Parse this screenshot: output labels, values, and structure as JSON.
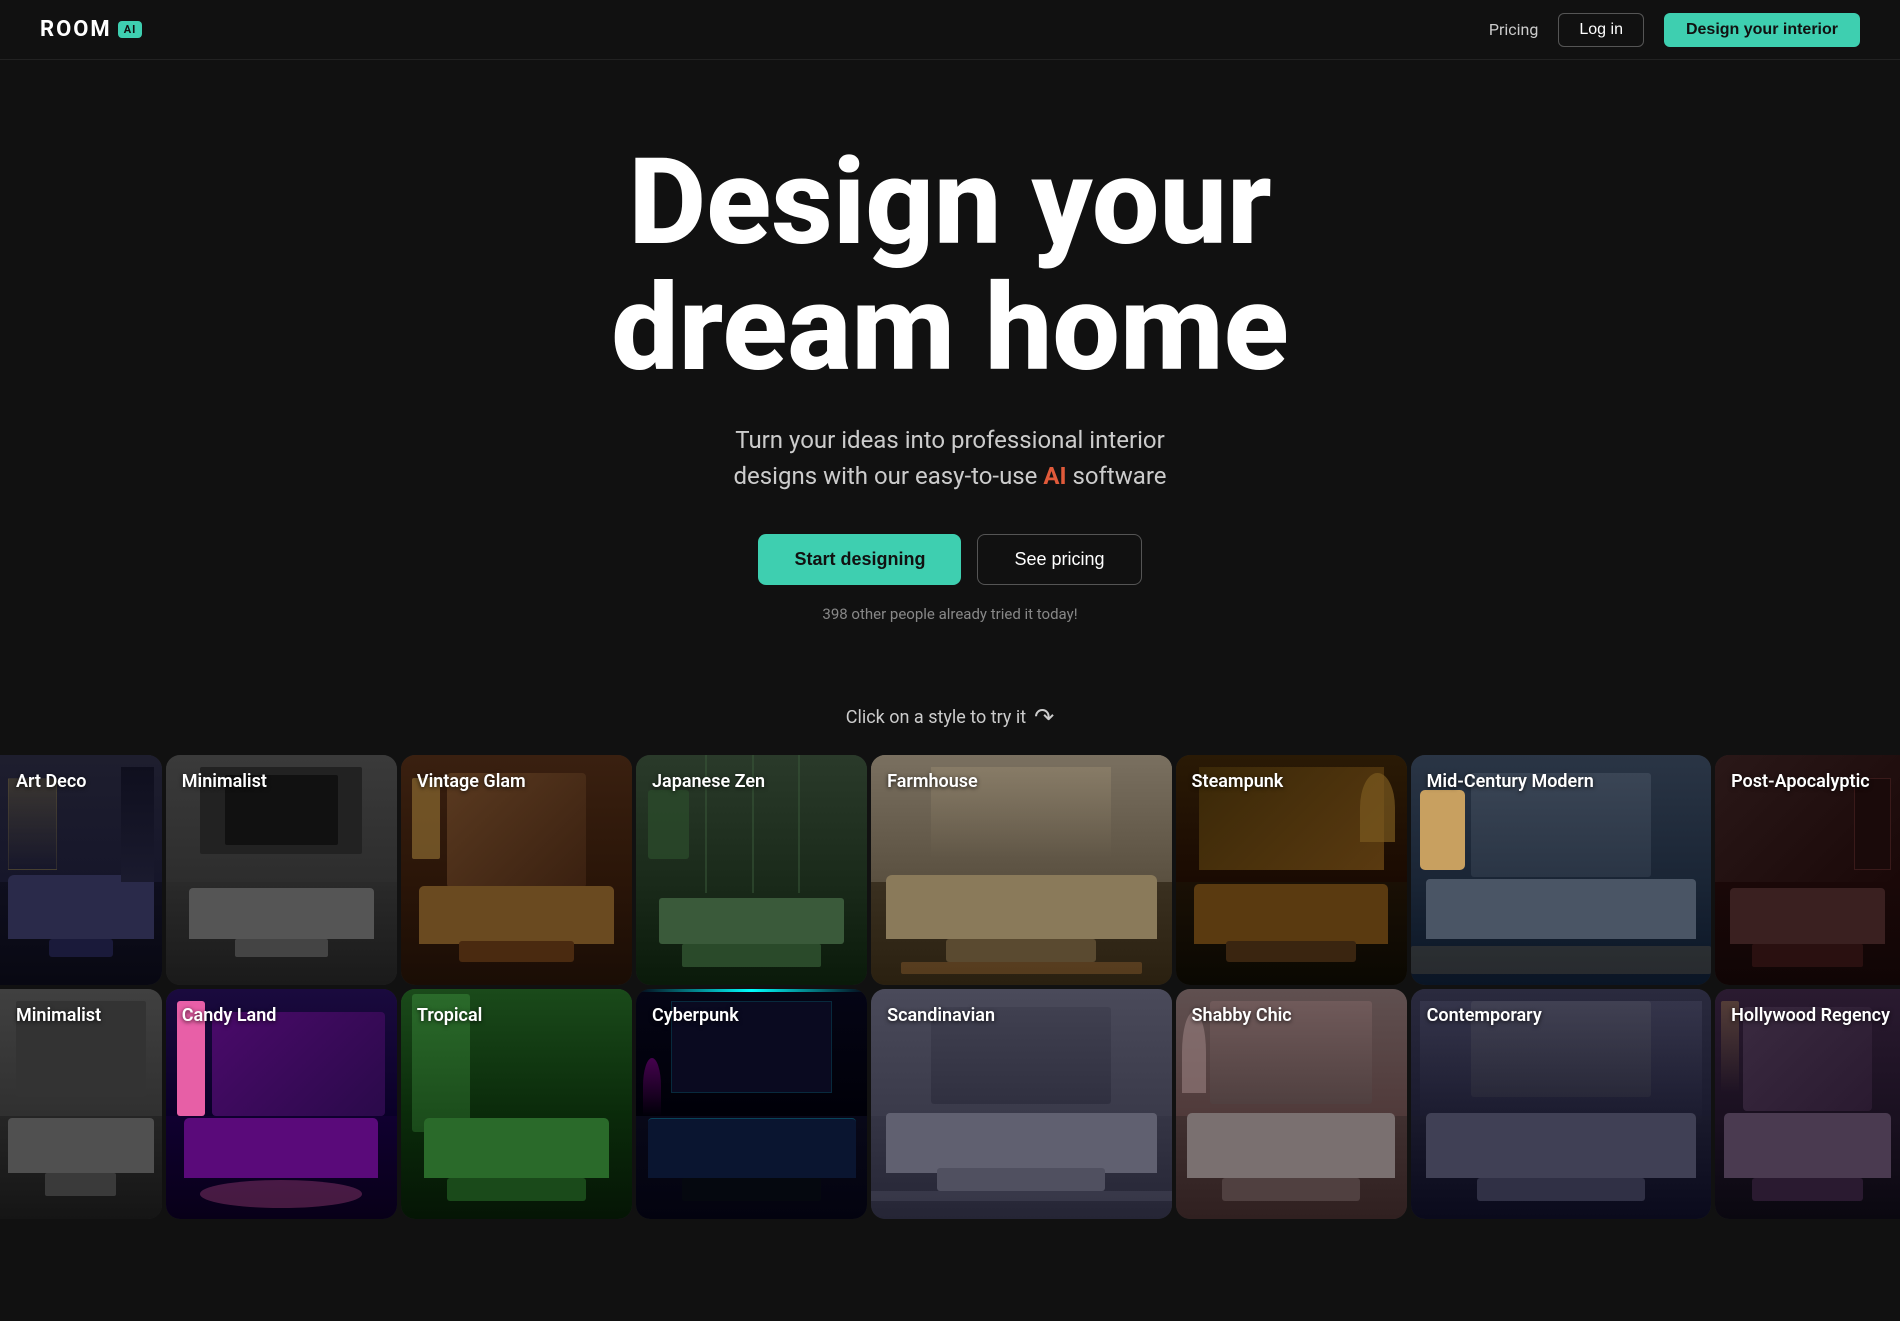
{
  "nav": {
    "logo_text": "ROOM",
    "logo_badge": "AI",
    "pricing_label": "Pricing",
    "login_label": "Log in",
    "cta_label": "Design your interior"
  },
  "hero": {
    "title_line1": "Design your",
    "title_line2": "dream home",
    "subtitle_part1": "Turn your ideas into professional interior",
    "subtitle_part2": "designs with our easy-to-use",
    "subtitle_ai": "AI",
    "subtitle_part3": "software",
    "btn_start": "Start designing",
    "btn_pricing": "See pricing",
    "social_proof": "398 other people already tried it today!"
  },
  "styles_section": {
    "hint_text": "Click on a style to try it",
    "row1": [
      {
        "id": "art-deco",
        "label": "Art Deco",
        "partial": "left"
      },
      {
        "id": "minimalist",
        "label": "Minimalist",
        "partial": ""
      },
      {
        "id": "vintage-glam",
        "label": "Vintage Glam",
        "partial": ""
      },
      {
        "id": "japanese-zen",
        "label": "Japanese Zen",
        "partial": ""
      },
      {
        "id": "farmhouse",
        "label": "Farmhouse",
        "partial": ""
      },
      {
        "id": "steampunk",
        "label": "Steampunk",
        "partial": ""
      },
      {
        "id": "mid-century-modern",
        "label": "Mid-Century Modern",
        "partial": ""
      },
      {
        "id": "post-apocalyptic",
        "label": "Post-Apocalyptic",
        "partial": "right"
      }
    ],
    "row2": [
      {
        "id": "minimalist2",
        "label": "Minimalist",
        "partial": "left"
      },
      {
        "id": "candy-land",
        "label": "Candy Land",
        "partial": ""
      },
      {
        "id": "tropical",
        "label": "Tropical",
        "partial": ""
      },
      {
        "id": "cyberpunk",
        "label": "Cyberpunk",
        "partial": ""
      },
      {
        "id": "scandinavian",
        "label": "Scandinavian",
        "partial": ""
      },
      {
        "id": "shabby-chic",
        "label": "Shabby Chic",
        "partial": ""
      },
      {
        "id": "contemporary",
        "label": "Contemporary",
        "partial": ""
      },
      {
        "id": "hollywood-regency",
        "label": "Hollywood Regency",
        "partial": "right"
      }
    ]
  },
  "colors": {
    "teal": "#3ecfb0",
    "orange": "#e05a3a",
    "dark_bg": "#111111",
    "border": "#333333"
  },
  "room_styles": {
    "art-deco": {
      "wall": "#1e1e2e",
      "floor": "#0f0f1e",
      "sofa": "#2a2a4a",
      "table": "#1a1a3a",
      "accent1": "#8a7a3a",
      "accent2": "#4a3a8a"
    },
    "minimalist": {
      "wall": "#3a3a3a",
      "floor": "#2a2a2a",
      "sofa": "#4a4a4a",
      "table": "#383838",
      "accent1": "#606060",
      "accent2": "#505050"
    },
    "vintage-glam": {
      "wall": "#3a2010",
      "floor": "#2a1508",
      "sofa": "#5a3a20",
      "table": "#4a2a15",
      "accent1": "#8a6a30",
      "accent2": "#6a4a20"
    },
    "japanese-zen": {
      "wall": "#2a3a2a",
      "floor": "#1a2a1a",
      "sofa": "#3a5a3a",
      "table": "#2a4a2a",
      "accent1": "#5a7a5a",
      "accent2": "#4a6a4a"
    },
    "farmhouse": {
      "wall": "#5a5040",
      "floor": "#3a3025",
      "sofa": "#7a6a4a",
      "table": "#5a4a30",
      "accent1": "#9a8a6a",
      "accent2": "#7a6a4a"
    },
    "steampunk": {
      "wall": "#3a2808",
      "floor": "#1a1208",
      "sofa": "#5a3a10",
      "table": "#3a2808",
      "accent1": "#7a5a20",
      "accent2": "#9a7a30"
    },
    "mid-century-modern": {
      "wall": "#2a3545",
      "floor": "#1a2535",
      "sofa": "#3a4555",
      "table": "#2a3545",
      "accent1": "#c8a060",
      "accent2": "#4a5565"
    },
    "post-apocalyptic": {
      "wall": "#2a1818",
      "floor": "#1a0808",
      "sofa": "#3a2020",
      "table": "#2a1010",
      "accent1": "#5a3a3a",
      "accent2": "#4a2a2a"
    },
    "candy-land": {
      "wall": "#2a1a3e",
      "floor": "#1a0a2e",
      "sofa": "#5a1a7a",
      "table": "#3a0a5a",
      "accent1": "#ff69b4",
      "accent2": "#ff1493"
    },
    "tropical": {
      "wall": "#1a4a1a",
      "floor": "#0a2a0a",
      "sofa": "#2a6a2a",
      "table": "#1a4a1a",
      "accent1": "#3a8a3a",
      "accent2": "#50a050"
    },
    "cyberpunk": {
      "wall": "#0a0a20",
      "floor": "#050510",
      "sofa": "#0a1530",
      "table": "#050a20",
      "accent1": "#00ffff",
      "accent2": "#ff00ff"
    },
    "scandinavian": {
      "wall": "#404050",
      "floor": "#303040",
      "sofa": "#505060",
      "table": "#404050",
      "accent1": "#808090",
      "accent2": "#909090"
    },
    "shabby-chic": {
      "wall": "#5a5050",
      "floor": "#3a3030",
      "sofa": "#7a7070",
      "table": "#5a5050",
      "accent1": "#9a9090",
      "accent2": "#8a8080"
    },
    "contemporary": {
      "wall": "#303045",
      "floor": "#1a1a2c",
      "sofa": "#404055",
      "table": "#303045",
      "accent1": "#606075",
      "accent2": "#505065"
    },
    "hollywood-regency": {
      "wall": "#3a2a40",
      "floor": "#201520",
      "sofa": "#4a3a50",
      "table": "#3a2a40",
      "accent1": "#c8a050",
      "accent2": "#8a6030"
    }
  }
}
